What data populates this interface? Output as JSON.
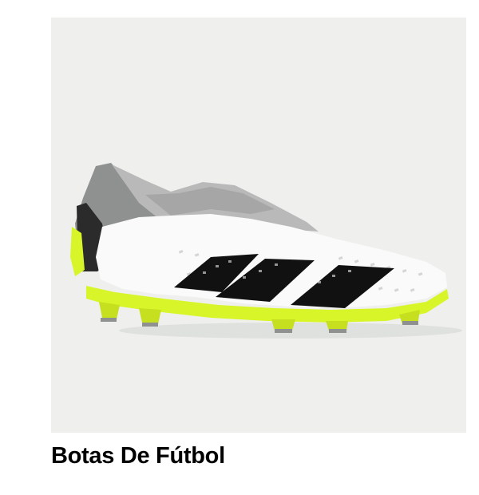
{
  "product_card": {
    "title": "Botas De Fútbol",
    "image_icon": "football-boot-image"
  },
  "colors": {
    "image_background": "#eff0ee",
    "title_text": "#000000",
    "boot_upper": "#ffffff",
    "boot_collar": "#b9b9b9",
    "boot_stripes": "#111111",
    "soleplate": "#d8f52a"
  }
}
